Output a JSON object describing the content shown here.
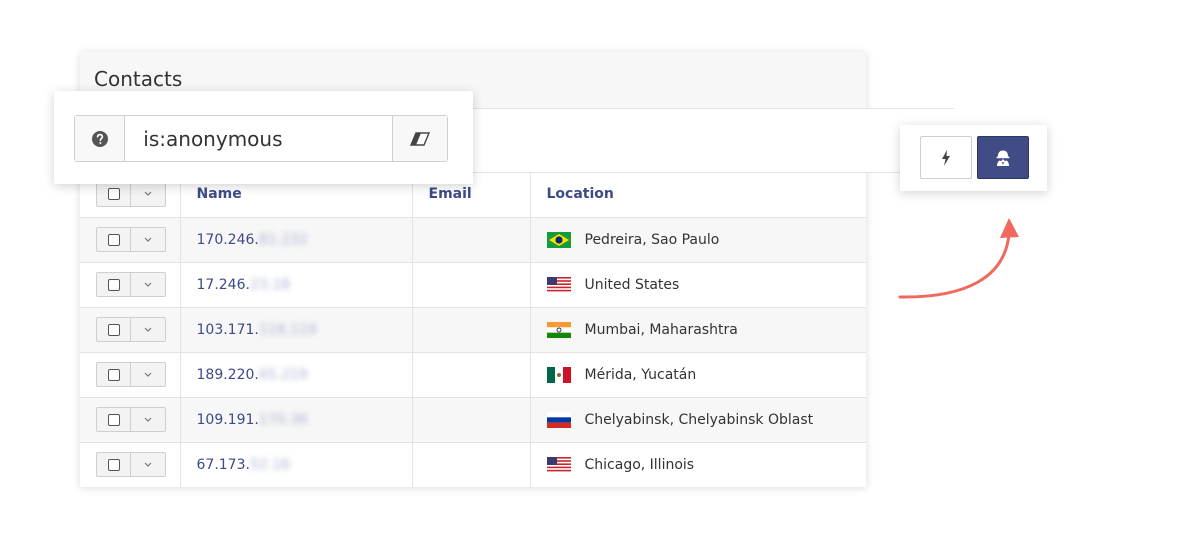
{
  "card": {
    "title": "Contacts"
  },
  "search": {
    "value": "is:anonymous",
    "help_icon": "question-circle-icon",
    "clear_icon": "eraser-icon"
  },
  "table": {
    "headers": {
      "name": "Name",
      "email": "Email",
      "location": "Location"
    },
    "rows": [
      {
        "ip_visible": "170.246.",
        "ip_hidden": "81.232",
        "email": "",
        "flag": "brazil-flag-icon",
        "location": "Pedreira, Sao Paulo"
      },
      {
        "ip_visible": "17.246.",
        "ip_hidden": "23.18",
        "email": "",
        "flag": "usa-flag-icon",
        "location": "United States"
      },
      {
        "ip_visible": "103.171.",
        "ip_hidden": "118.119",
        "email": "",
        "flag": "india-flag-icon",
        "location": "Mumbai, Maharashtra"
      },
      {
        "ip_visible": "189.220.",
        "ip_hidden": "65.219",
        "email": "",
        "flag": "mexico-flag-icon",
        "location": "Mérida, Yucatán"
      },
      {
        "ip_visible": "109.191.",
        "ip_hidden": "170.36",
        "email": "",
        "flag": "russia-flag-icon",
        "location": "Chelyabinsk, Chelyabinsk Oblast"
      },
      {
        "ip_visible": "67.173.",
        "ip_hidden": "52.16",
        "email": "",
        "flag": "usa-flag-icon",
        "location": "Chicago, Illinois"
      }
    ]
  },
  "actions": {
    "bolt_icon": "lightning-bolt-icon",
    "anonymous_icon": "anonymous-user-icon"
  },
  "colors": {
    "accent": "#3d4a8a",
    "button_active": "#414b86",
    "arrow": "#f0685e"
  }
}
